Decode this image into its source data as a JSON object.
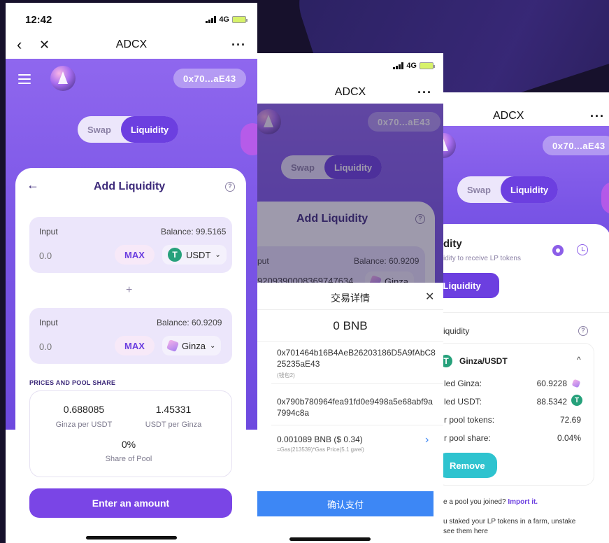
{
  "screen1": {
    "time": "12:42",
    "network": "4G",
    "nav_title": "ADCX",
    "nav_more": "···",
    "address": "0x70...aE43",
    "tabs": [
      "Swap",
      "Liquidity"
    ],
    "active_tab": "Liquidity",
    "card_title": "Add Liquidity",
    "input1": {
      "label": "Input",
      "balance": "Balance: 99.5165",
      "value": "0.0",
      "max": "MAX",
      "token": "USDT"
    },
    "plus": "+",
    "input2": {
      "label": "Input",
      "balance": "Balance: 60.9209",
      "value": "0.0",
      "max": "MAX",
      "token": "Ginza"
    },
    "prices_label": "PRICES AND POOL SHARE",
    "prices": [
      {
        "value": "0.688085",
        "label": "Ginza per USDT"
      },
      {
        "value": "1.45331",
        "label": "USDT per Ginza"
      },
      {
        "value": "0%",
        "label": "Share of Pool"
      }
    ],
    "button": "Enter an amount"
  },
  "screen2": {
    "network": "4G",
    "nav_title": "ADCX",
    "nav_more": "···",
    "address": "0x70...aE43",
    "tabs": [
      "Swap",
      "Liquidity"
    ],
    "card_title": "Add Liquidity",
    "input_label": "put",
    "balance": "Balance: 60.9209",
    "input_value": "9209390008369747634",
    "token": "Ginza",
    "sheet": {
      "title": "交易详情",
      "close": "✕",
      "amount": "0 BNB",
      "from_address": "0x701464b16B4AeB26203186D5A9fAbC825235aE43",
      "from_wallet": "(钱包2)",
      "to_address": "0x790b780964fea91fd0e9498a5e68abf9a7994c8a",
      "fee": "0.001089 BNB ($ 0.34)",
      "fee_formula": "=Gas(213539)*Gas Price(5.1 gwei)",
      "confirm": "确认支付"
    }
  },
  "screen3": {
    "nav_title": "ADCX",
    "nav_more": "···",
    "address": "0x70...aE43",
    "tabs": [
      "Swap",
      "Liquidity"
    ],
    "card_heading": "dity",
    "card_sub": "idity to receive LP tokens",
    "add_button": "d Liquidity",
    "section": "iquidity",
    "pair": "Ginza/USDT",
    "rows": [
      {
        "label": "led Ginza:",
        "value": "60.9228"
      },
      {
        "label": "led USDT:",
        "value": "88.5342"
      },
      {
        "label": "r pool tokens:",
        "value": "72.69"
      },
      {
        "label": "r pool share:",
        "value": "0.04%"
      }
    ],
    "remove": "Remove",
    "import_text": "e a pool you joined?",
    "import_link": "Import it.",
    "farm_text": "u staked your LP tokens in a farm, unstake",
    "farm_text2": "see them here"
  },
  "colors": {
    "purple": "#6c3fe0",
    "teal": "#2ec3cf",
    "blue": "#3d87f5",
    "usdt": "#26a17b"
  }
}
